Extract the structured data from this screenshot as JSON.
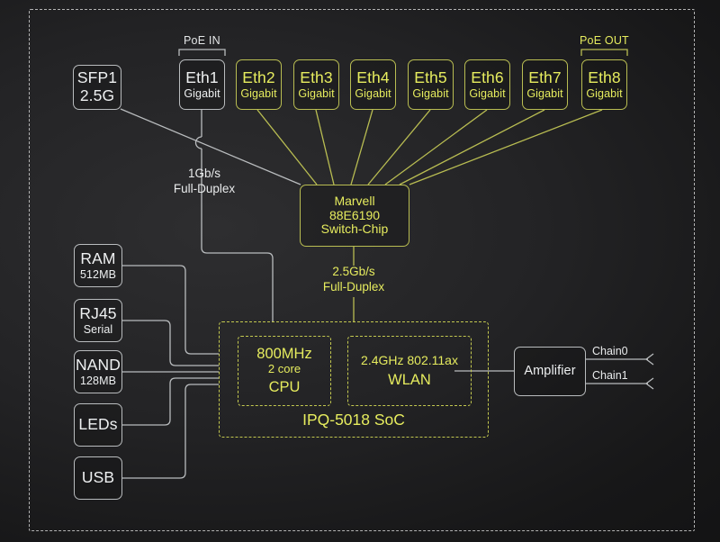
{
  "diagram": {
    "title": "IPQ-5018 SoC router block diagram",
    "colors": {
      "accent_yellow": "#e6ec5e",
      "line_white": "#b9bcbe",
      "line_yellow": "#b9bd52",
      "background": "#232325"
    }
  },
  "ports": {
    "poe_in_label": "PoE IN",
    "poe_out_label": "PoE OUT",
    "sfp": {
      "name": "SFP1",
      "speed": "2.5G"
    },
    "ethernet": [
      {
        "name": "Eth1",
        "speed": "Gigabit",
        "accent": false
      },
      {
        "name": "Eth2",
        "speed": "Gigabit",
        "accent": true
      },
      {
        "name": "Eth3",
        "speed": "Gigabit",
        "accent": true
      },
      {
        "name": "Eth4",
        "speed": "Gigabit",
        "accent": true
      },
      {
        "name": "Eth5",
        "speed": "Gigabit",
        "accent": true
      },
      {
        "name": "Eth6",
        "speed": "Gigabit",
        "accent": true
      },
      {
        "name": "Eth7",
        "speed": "Gigabit",
        "accent": true
      },
      {
        "name": "Eth8",
        "speed": "Gigabit",
        "accent": true
      }
    ]
  },
  "switch_chip": {
    "line1": "Marvell",
    "line2": "88E6190",
    "line3": "Switch-Chip"
  },
  "links": {
    "sfp_link": {
      "speed": "1Gb/s",
      "duplex": "Full-Duplex"
    },
    "switch_link": {
      "speed": "2.5Gb/s",
      "duplex": "Full-Duplex"
    }
  },
  "peripherals": [
    {
      "name": "RAM",
      "detail": "512MB"
    },
    {
      "name": "RJ45",
      "detail": "Serial"
    },
    {
      "name": "NAND",
      "detail": "128MB"
    },
    {
      "name": "LEDs",
      "detail": ""
    },
    {
      "name": "USB",
      "detail": ""
    }
  ],
  "soc": {
    "title": "IPQ-5018 SoC",
    "cpu": {
      "freq": "800MHz",
      "cores": "2 core",
      "label": "CPU"
    },
    "wlan": {
      "spec": "2.4GHz 802.11ax",
      "label": "WLAN"
    }
  },
  "radio": {
    "amplifier": "Amplifier",
    "chains": [
      "Chain0",
      "Chain1"
    ]
  }
}
